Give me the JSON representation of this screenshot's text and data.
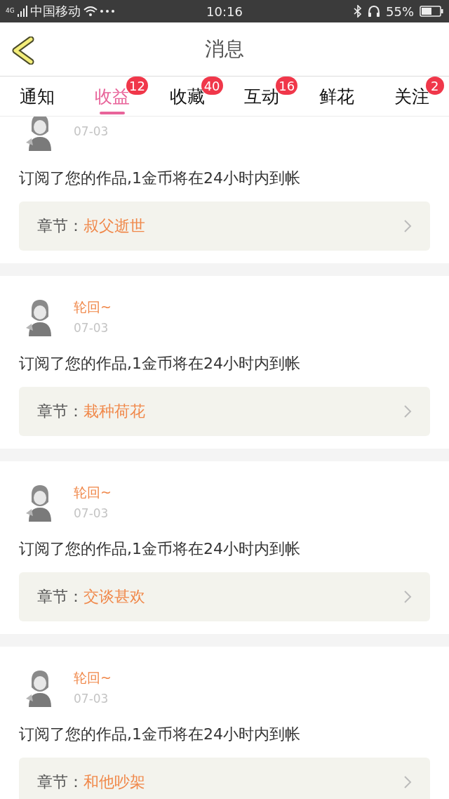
{
  "status_bar": {
    "network": "4G",
    "carrier": "中国移动",
    "time": "10:16",
    "battery": "55%"
  },
  "header": {
    "title": "消息"
  },
  "tabs": [
    {
      "label": "通知",
      "selected": false
    },
    {
      "label": "收益",
      "selected": true,
      "badge": "12"
    },
    {
      "label": "收藏",
      "selected": false,
      "badge": "40"
    },
    {
      "label": "互动",
      "selected": false,
      "badge": "16"
    },
    {
      "label": "鲜花",
      "selected": false
    },
    {
      "label": "关注",
      "selected": false,
      "badge": "2"
    }
  ],
  "messages": [
    {
      "date": "07-03",
      "text": "订阅了您的作品,1金币将在24小时内到帐",
      "chapter_label": "章节：",
      "chapter": "叔父逝世"
    },
    {
      "user": "轮回~",
      "date": "07-03",
      "text": "订阅了您的作品,1金币将在24小时内到帐",
      "chapter_label": "章节：",
      "chapter": "栽种荷花"
    },
    {
      "user": "轮回~",
      "date": "07-03",
      "text": "订阅了您的作品,1金币将在24小时内到帐",
      "chapter_label": "章节：",
      "chapter": "交谈甚欢"
    },
    {
      "user": "轮回~",
      "date": "07-03",
      "text": "订阅了您的作品,1金币将在24小时内到帐",
      "chapter_label": "章节：",
      "chapter": "和他吵架"
    }
  ]
}
